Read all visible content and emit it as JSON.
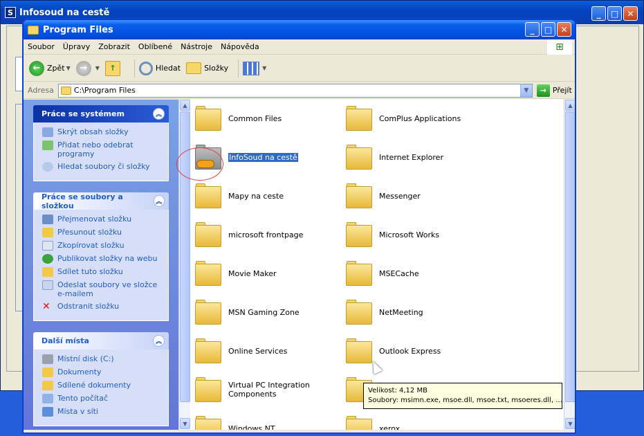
{
  "background_window": {
    "title": "Infosoud na cestě"
  },
  "window": {
    "title": "Program Files",
    "controls": {
      "minimize": "_",
      "maximize": "□",
      "close": "✕"
    }
  },
  "menu": [
    "Soubor",
    "Úpravy",
    "Zobrazit",
    "Oblíbené",
    "Nástroje",
    "Nápověda"
  ],
  "toolbar": {
    "back": "Zpět",
    "search": "Hledat",
    "folders": "Složky"
  },
  "address": {
    "label": "Adresa",
    "value": "C:\\Program Files",
    "go": "Přejít"
  },
  "task_pane": {
    "system": {
      "title": "Práce se systémem",
      "items": [
        "Skrýt obsah složky",
        "Přidat nebo odebrat programy",
        "Hledat soubory či složky"
      ]
    },
    "files": {
      "title": "Práce se soubory a složkou",
      "items": [
        "Přejmenovat složku",
        "Přesunout složku",
        "Zkopírovat složku",
        "Publikovat složky na webu",
        "Sdílet tuto složku",
        "Odeslat soubory ve složce e-mailem",
        "Odstranit složku"
      ]
    },
    "places": {
      "title": "Další místa",
      "items": [
        "Místní disk (C:)",
        "Dokumenty",
        "Sdílené dokumenty",
        "Tento počítač",
        "Místa v síti"
      ]
    }
  },
  "folders": [
    "Common Files",
    "ComPlus Applications",
    "InfoSoud na cestě",
    "Internet Explorer",
    "Mapy na ceste",
    "Messenger",
    "microsoft frontpage",
    "Microsoft Works",
    "Movie Maker",
    "MSECache",
    "MSN Gaming Zone",
    "NetMeeting",
    "Online Services",
    "Outlook Express",
    "Virtual PC Integration Components",
    "",
    "Windows NT",
    "xerox"
  ],
  "tooltip": {
    "line1": "Velikost: 4,12 MB",
    "line2": "Soubory: msimn.exe, msoe.dll, msoe.txt, msoeres.dll, ..."
  },
  "colors": {
    "selection": "#316ac5",
    "link": "#215dc6",
    "highlight_circle": "#e04040"
  }
}
